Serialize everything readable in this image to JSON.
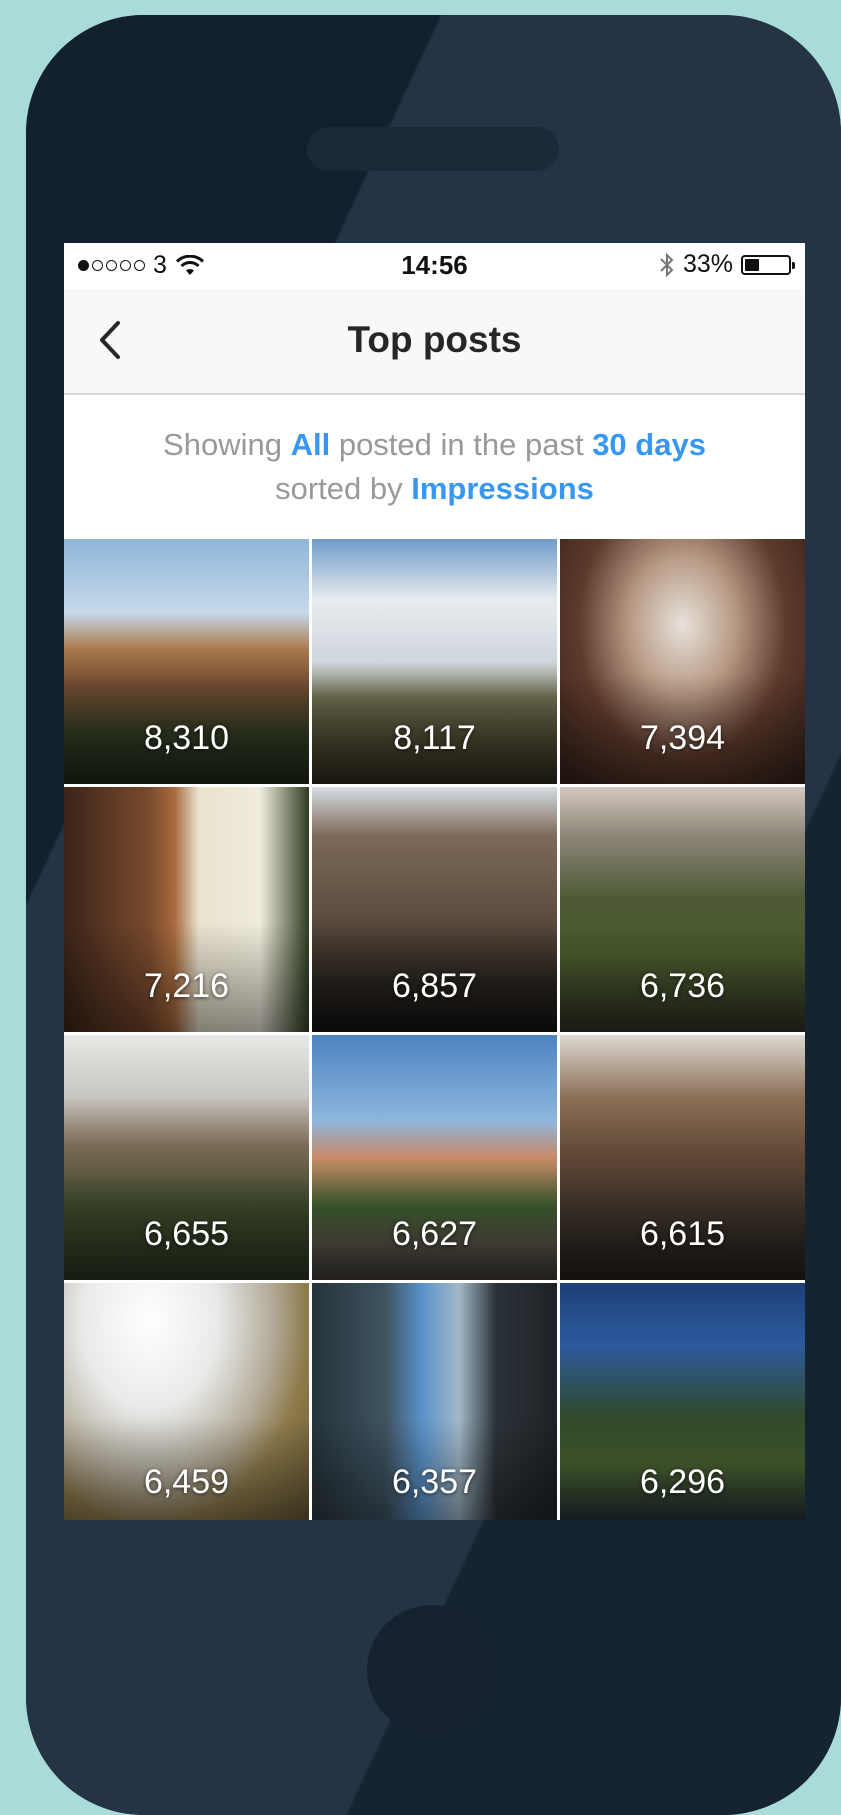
{
  "status_bar": {
    "carrier": "3",
    "time": "14:56",
    "battery_percent": "33%",
    "battery_level": 0.33,
    "signal_bars": 1,
    "signal_total": 5
  },
  "nav": {
    "title": "Top posts"
  },
  "filter": {
    "prefix": "Showing",
    "content_type": "All",
    "middle": "posted in the past",
    "period": "30 days",
    "sorted_by_text": "sorted by",
    "metric": "Impressions"
  },
  "posts": [
    {
      "value": "8,310"
    },
    {
      "value": "8,117"
    },
    {
      "value": "7,394"
    },
    {
      "value": "7,216"
    },
    {
      "value": "6,857"
    },
    {
      "value": "6,736"
    },
    {
      "value": "6,655"
    },
    {
      "value": "6,627"
    },
    {
      "value": "6,615"
    },
    {
      "value": "6,459"
    },
    {
      "value": "6,357"
    },
    {
      "value": "6,296"
    }
  ],
  "colors": {
    "accent": "#3897f0",
    "background": "#a9dcd9",
    "phone_body": "#1a2a3a"
  }
}
